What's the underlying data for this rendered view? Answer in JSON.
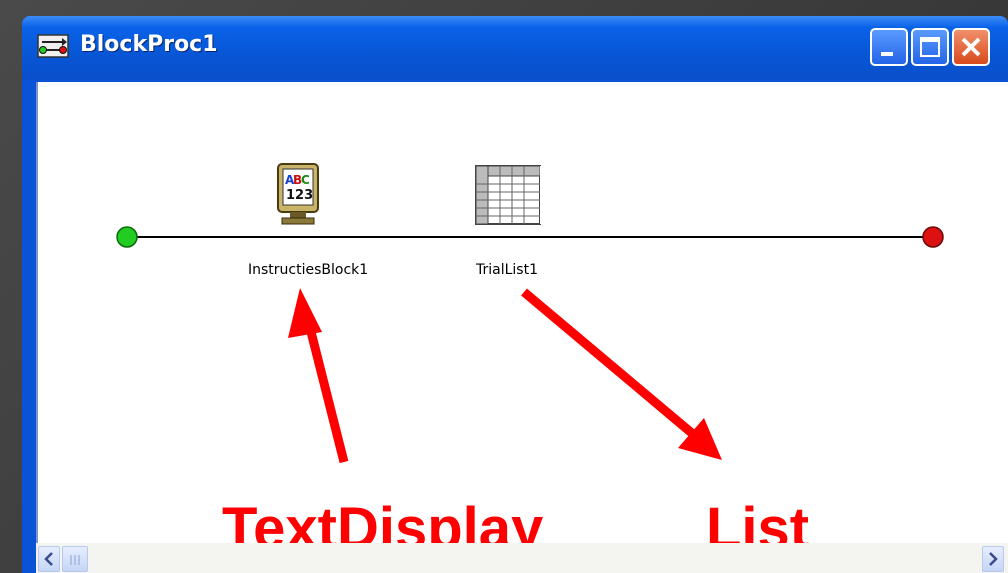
{
  "window": {
    "title": "BlockProc1",
    "controls": [
      "minimize-icon",
      "maximize-icon",
      "close-icon"
    ]
  },
  "timeline": {
    "start_color": "#22cc22",
    "end_color": "#dd1111",
    "nodes": [
      {
        "label": "InstructiesBlock1",
        "icon": "text-display-icon"
      },
      {
        "label": "TrialList1",
        "icon": "list-icon"
      }
    ]
  },
  "annotations": {
    "color": "#ff0000",
    "labels": [
      "TextDisplay",
      "List"
    ]
  },
  "scrollbar": {
    "left_icon": "chevron-left-icon",
    "right_icon": "chevron-right-icon"
  }
}
